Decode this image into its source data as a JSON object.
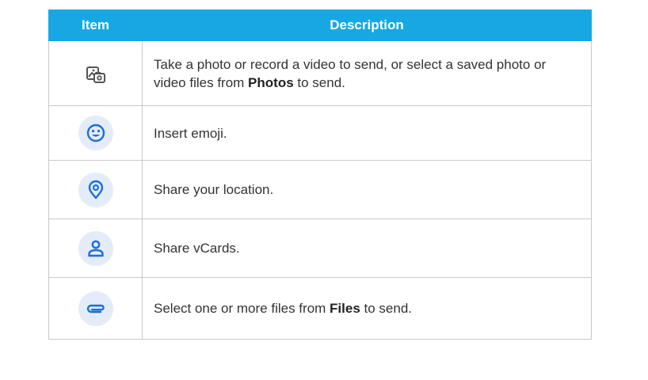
{
  "table": {
    "headers": {
      "item": "Item",
      "description": "Description"
    },
    "rows": [
      {
        "icon": "gallery-camera-icon",
        "text_before": "Take a photo or record a video to send, or select a saved photo or video files from ",
        "bold": "Photos",
        "text_after": " to send."
      },
      {
        "icon": "emoji-icon",
        "text_before": "Insert emoji.",
        "bold": "",
        "text_after": ""
      },
      {
        "icon": "location-pin-icon",
        "text_before": "Share your location.",
        "bold": "",
        "text_after": ""
      },
      {
        "icon": "contact-person-icon",
        "text_before": "Share vCards.",
        "bold": "",
        "text_after": ""
      },
      {
        "icon": "paperclip-icon",
        "text_before": "Select one or more files from ",
        "bold": "Files",
        "text_after": " to send."
      }
    ]
  },
  "colors": {
    "header": "#17a8e3",
    "icon_blue": "#1a6fd8",
    "icon_bg": "#e3ecf8"
  }
}
